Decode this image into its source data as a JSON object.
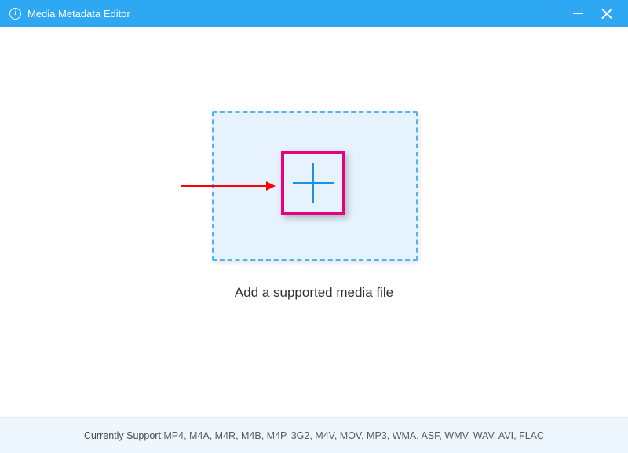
{
  "titlebar": {
    "icon_glyph": "i",
    "title": "Media Metadata Editor"
  },
  "main": {
    "instruction": "Add a supported media file"
  },
  "footer": {
    "label": "Currently Support: ",
    "formats": "MP4, M4A, M4R, M4B, M4P, 3G2, M4V, MOV, MP3, WMA, ASF, WMV, WAV, AVI, FLAC"
  }
}
